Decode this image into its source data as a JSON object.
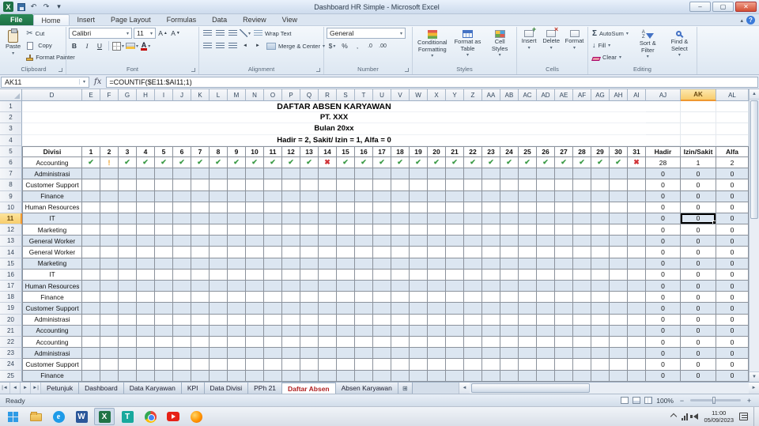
{
  "window": {
    "title": "Dashboard HR Simple  -  Microsoft Excel",
    "controls": {
      "minimize": "–",
      "maximize": "▢",
      "close": "✕"
    }
  },
  "ribbon": {
    "tabs": [
      "File",
      "Home",
      "Insert",
      "Page Layout",
      "Formulas",
      "Data",
      "Review",
      "View"
    ],
    "active_tab": "Home",
    "groups": [
      "Clipboard",
      "Font",
      "Alignment",
      "Number",
      "Styles",
      "Cells",
      "Editing"
    ],
    "clipboard": {
      "paste": "Paste",
      "cut": "Cut",
      "copy": "Copy",
      "format_painter": "Format Painter"
    },
    "font": {
      "name": "Calibri",
      "size": "11"
    },
    "alignment": {
      "wrap": "Wrap Text",
      "merge": "Merge & Center"
    },
    "number": {
      "format": "General"
    },
    "styles": {
      "conditional": "Conditional Formatting",
      "format_table": "Format as Table",
      "cell_styles": "Cell Styles"
    },
    "cells": {
      "insert": "Insert",
      "delete": "Delete",
      "format": "Format"
    },
    "editing": {
      "autosum": "AutoSum",
      "fill": "Fill",
      "clear": "Clear",
      "sort": "Sort & Filter",
      "find": "Find & Select"
    }
  },
  "formula_bar": {
    "name_box": "AK11",
    "fx_label": "fx",
    "formula": "=COUNTIF($E11:$AI11;1)"
  },
  "sheet": {
    "columns": [
      "D",
      "E",
      "F",
      "G",
      "H",
      "I",
      "J",
      "K",
      "L",
      "M",
      "N",
      "O",
      "P",
      "Q",
      "R",
      "S",
      "T",
      "U",
      "V",
      "W",
      "X",
      "Y",
      "Z",
      "AA",
      "AB",
      "AC",
      "AD",
      "AE",
      "AF",
      "AG",
      "AH",
      "AI",
      "AJ",
      "AK",
      "AL"
    ],
    "selected_column": "AK",
    "selected_row": 11,
    "title_rows": [
      "DAFTAR ABSEN KARYAWAN",
      "PT. XXX",
      "Bulan 20xx",
      "Hadir = 2, Sakit/ Izin = 1, Alfa = 0"
    ],
    "header": {
      "divisi": "Divisi",
      "days": [
        1,
        2,
        3,
        4,
        5,
        6,
        7,
        8,
        9,
        10,
        11,
        12,
        13,
        14,
        15,
        16,
        17,
        18,
        19,
        20,
        21,
        22,
        23,
        24,
        25,
        26,
        27,
        28,
        29,
        30,
        31
      ],
      "hadir": "Hadir",
      "izin": "Izin/Sakit",
      "alfa": "Alfa"
    },
    "mark_glyphs": {
      "c": {
        "glyph": "✔",
        "color": "#3a9a45"
      },
      "s": {
        "glyph": "!",
        "color": "#ef9f26"
      },
      "x": {
        "glyph": "✖",
        "color": "#d13438"
      }
    },
    "rows": [
      {
        "n": 6,
        "divisi": "Accounting",
        "marks": [
          "c",
          "s",
          "c",
          "c",
          "c",
          "c",
          "c",
          "c",
          "c",
          "c",
          "c",
          "c",
          "c",
          "x",
          "c",
          "c",
          "c",
          "c",
          "c",
          "c",
          "c",
          "c",
          "c",
          "c",
          "c",
          "c",
          "c",
          "c",
          "c",
          "c",
          "x"
        ],
        "hadir": "28",
        "izin": "1",
        "alfa": "2"
      },
      {
        "n": 7,
        "divisi": "Administrasi",
        "hadir": "0",
        "izin": "0",
        "alfa": "0"
      },
      {
        "n": 8,
        "divisi": "Customer Support",
        "hadir": "0",
        "izin": "0",
        "alfa": "0"
      },
      {
        "n": 9,
        "divisi": "Finance",
        "hadir": "0",
        "izin": "0",
        "alfa": "0"
      },
      {
        "n": 10,
        "divisi": "Human Resources",
        "hadir": "0",
        "izin": "0",
        "alfa": "0"
      },
      {
        "n": 11,
        "divisi": "IT",
        "hadir": "0",
        "izin": "0",
        "alfa": "0"
      },
      {
        "n": 12,
        "divisi": "Marketing",
        "hadir": "0",
        "izin": "0",
        "alfa": "0"
      },
      {
        "n": 13,
        "divisi": "General Worker",
        "hadir": "0",
        "izin": "0",
        "alfa": "0"
      },
      {
        "n": 14,
        "divisi": "General Worker",
        "hadir": "0",
        "izin": "0",
        "alfa": "0"
      },
      {
        "n": 15,
        "divisi": "Marketing",
        "hadir": "0",
        "izin": "0",
        "alfa": "0"
      },
      {
        "n": 16,
        "divisi": "IT",
        "hadir": "0",
        "izin": "0",
        "alfa": "0"
      },
      {
        "n": 17,
        "divisi": "Human Resources",
        "hadir": "0",
        "izin": "0",
        "alfa": "0"
      },
      {
        "n": 18,
        "divisi": "Finance",
        "hadir": "0",
        "izin": "0",
        "alfa": "0"
      },
      {
        "n": 19,
        "divisi": "Customer Support",
        "hadir": "0",
        "izin": "0",
        "alfa": "0"
      },
      {
        "n": 20,
        "divisi": "Administrasi",
        "hadir": "0",
        "izin": "0",
        "alfa": "0"
      },
      {
        "n": 21,
        "divisi": "Accounting",
        "hadir": "0",
        "izin": "0",
        "alfa": "0"
      },
      {
        "n": 22,
        "divisi": "Accounting",
        "hadir": "0",
        "izin": "0",
        "alfa": "0"
      },
      {
        "n": 23,
        "divisi": "Administrasi",
        "hadir": "0",
        "izin": "0",
        "alfa": "0"
      },
      {
        "n": 24,
        "divisi": "Customer Support",
        "hadir": "0",
        "izin": "0",
        "alfa": "0"
      },
      {
        "n": 25,
        "divisi": "Finance",
        "hadir": "0",
        "izin": "0",
        "alfa": "0"
      }
    ]
  },
  "sheet_tabs": {
    "tabs": [
      "Petunjuk",
      "Dashboard",
      "Data Karyawan",
      "KPI",
      "Data Divisi",
      "PPh 21",
      "Daftar Absen",
      "Absen Karyawan"
    ],
    "active": "Daftar Absen"
  },
  "status_bar": {
    "mode": "Ready",
    "zoom": "100%"
  },
  "taskbar": {
    "time": "11:00",
    "date": "05/09/2023"
  },
  "colors": {
    "selection_gold": "#f8cd6d",
    "stripe_blue": "#dce6f1",
    "file_tab_green": "#1e7145",
    "active_sheet_text": "#b02020",
    "check_green": "#3a9a45",
    "absent_red": "#d13438",
    "sick_orange": "#ef9f26"
  }
}
